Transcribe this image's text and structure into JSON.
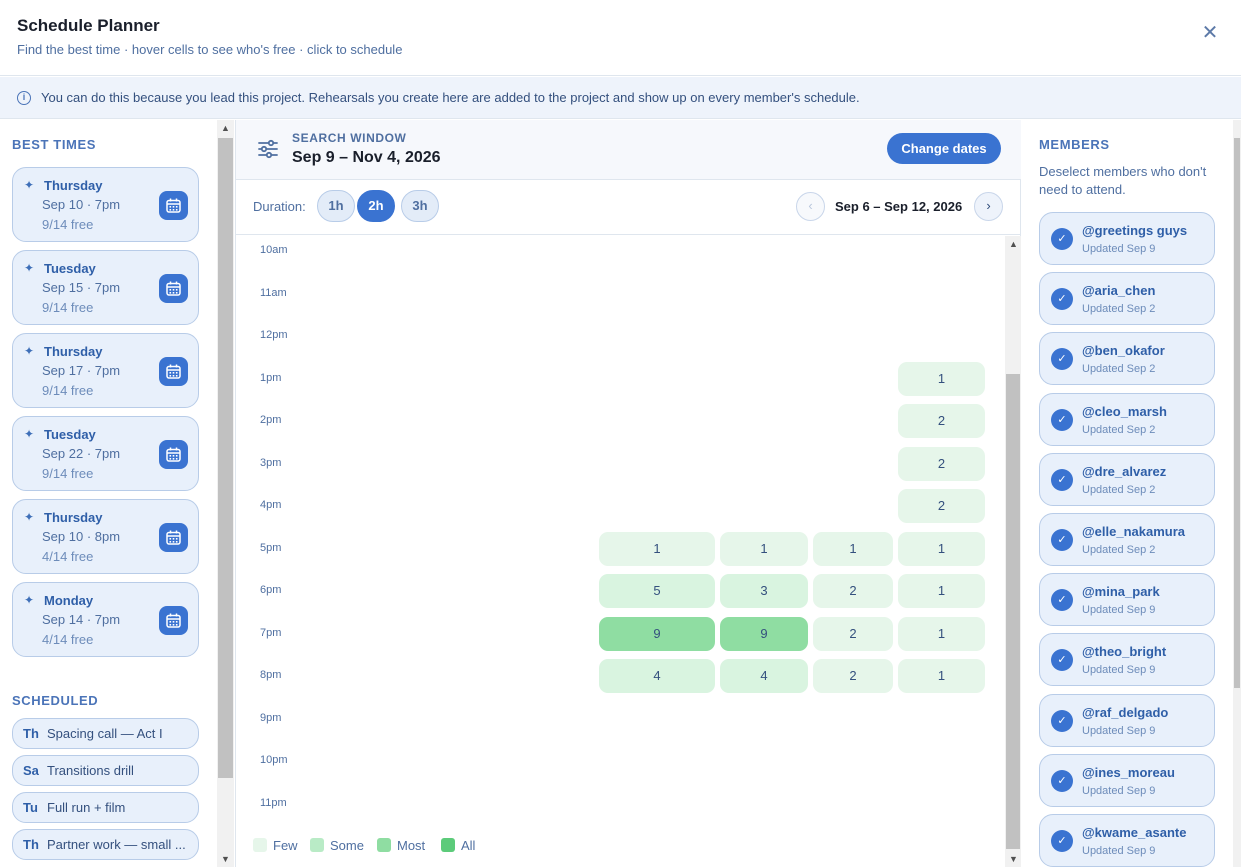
{
  "header": {
    "title": "Schedule Planner",
    "subtitle": "Find the best time · hover cells to see who's free · click to schedule"
  },
  "notice": {
    "icon": "info-icon",
    "text": "You can do this because you lead this project. Rehearsals you create here are added to the project and show up on every member's schedule."
  },
  "best_times": {
    "label": "BEST TIMES",
    "items": [
      {
        "day": "Thursday",
        "time": "Sep 10 · 7pm",
        "free": "9/14 free"
      },
      {
        "day": "Tuesday",
        "time": "Sep 15 · 7pm",
        "free": "9/14 free"
      },
      {
        "day": "Thursday",
        "time": "Sep 17 · 7pm",
        "free": "9/14 free"
      },
      {
        "day": "Tuesday",
        "time": "Sep 22 · 7pm",
        "free": "9/14 free"
      },
      {
        "day": "Thursday",
        "time": "Sep 10 · 8pm",
        "free": "4/14 free"
      },
      {
        "day": "Monday",
        "time": "Sep 14 · 7pm",
        "free": "4/14 free"
      }
    ]
  },
  "scheduled": {
    "label": "SCHEDULED",
    "items": [
      {
        "day": "Th",
        "name": "Spacing call — Act I"
      },
      {
        "day": "Sa",
        "name": "Transitions drill"
      },
      {
        "day": "Tu",
        "name": "Full run + film"
      },
      {
        "day": "Th",
        "name": "Partner work — small ..."
      }
    ]
  },
  "search": {
    "label": "SEARCH WINDOW",
    "range": "Sep 9 – Nov 4, 2026",
    "change_label": "Change dates"
  },
  "duration": {
    "label": "Duration:",
    "options": [
      "1h",
      "2h",
      "3h"
    ],
    "selected": "2h"
  },
  "week": {
    "label": "Sep 6 – Sep 12, 2026",
    "prev_icon": "chevron-left-icon",
    "next_icon": "chevron-right-icon"
  },
  "hours": [
    "10am",
    "11am",
    "12pm",
    "1pm",
    "2pm",
    "3pm",
    "4pm",
    "5pm",
    "6pm",
    "7pm",
    "8pm",
    "9pm",
    "10pm",
    "11pm"
  ],
  "availability": [
    {
      "col": 3,
      "hour": "1pm",
      "count": "1",
      "level": "few"
    },
    {
      "col": 3,
      "hour": "2pm",
      "count": "2",
      "level": "few"
    },
    {
      "col": 3,
      "hour": "3pm",
      "count": "2",
      "level": "few"
    },
    {
      "col": 3,
      "hour": "4pm",
      "count": "2",
      "level": "few"
    },
    {
      "col": 0,
      "hour": "5pm",
      "count": "1",
      "level": "few"
    },
    {
      "col": 1,
      "hour": "5pm",
      "count": "1",
      "level": "few"
    },
    {
      "col": 2,
      "hour": "5pm",
      "count": "1",
      "level": "few"
    },
    {
      "col": 3,
      "hour": "5pm",
      "count": "1",
      "level": "few"
    },
    {
      "col": 0,
      "hour": "6pm",
      "count": "5",
      "level": "some"
    },
    {
      "col": 1,
      "hour": "6pm",
      "count": "3",
      "level": "some"
    },
    {
      "col": 2,
      "hour": "6pm",
      "count": "2",
      "level": "few"
    },
    {
      "col": 3,
      "hour": "6pm",
      "count": "1",
      "level": "few"
    },
    {
      "col": 0,
      "hour": "7pm",
      "count": "9",
      "level": "most"
    },
    {
      "col": 1,
      "hour": "7pm",
      "count": "9",
      "level": "most"
    },
    {
      "col": 2,
      "hour": "7pm",
      "count": "2",
      "level": "few"
    },
    {
      "col": 3,
      "hour": "7pm",
      "count": "1",
      "level": "few"
    },
    {
      "col": 0,
      "hour": "8pm",
      "count": "4",
      "level": "some"
    },
    {
      "col": 1,
      "hour": "8pm",
      "count": "4",
      "level": "some"
    },
    {
      "col": 2,
      "hour": "8pm",
      "count": "2",
      "level": "few"
    },
    {
      "col": 3,
      "hour": "8pm",
      "count": "1",
      "level": "few"
    }
  ],
  "legend": [
    {
      "label": "Few",
      "color": "#e6f6ea"
    },
    {
      "label": "Some",
      "color": "#b9ebc6"
    },
    {
      "label": "Most",
      "color": "#8fdda2"
    },
    {
      "label": "All",
      "color": "#5ccb7a"
    }
  ],
  "members": {
    "label": "MEMBERS",
    "help": "Deselect members who don't need to attend.",
    "items": [
      {
        "handle": "@greetings guys",
        "updated": "Updated Sep 9"
      },
      {
        "handle": "@aria_chen",
        "updated": "Updated Sep 2"
      },
      {
        "handle": "@ben_okafor",
        "updated": "Updated Sep 2"
      },
      {
        "handle": "@cleo_marsh",
        "updated": "Updated Sep 2"
      },
      {
        "handle": "@dre_alvarez",
        "updated": "Updated Sep 2"
      },
      {
        "handle": "@elle_nakamura",
        "updated": "Updated Sep 2"
      },
      {
        "handle": "@mina_park",
        "updated": "Updated Sep 9"
      },
      {
        "handle": "@theo_bright",
        "updated": "Updated Sep 9"
      },
      {
        "handle": "@raf_delgado",
        "updated": "Updated Sep 9"
      },
      {
        "handle": "@ines_moreau",
        "updated": "Updated Sep 9"
      },
      {
        "handle": "@kwame_asante",
        "updated": "Updated Sep 9"
      }
    ]
  },
  "colors": {
    "accent": "#3a73d1",
    "level_few": "#e6f6ea",
    "level_some": "#d9f4e0",
    "level_most": "#8fdda2"
  }
}
